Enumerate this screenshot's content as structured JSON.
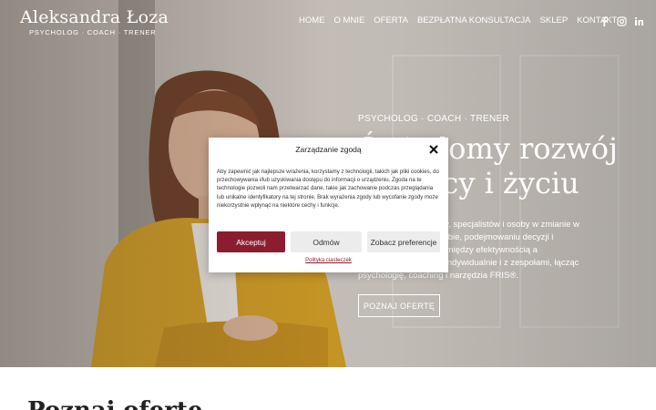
{
  "header": {
    "logo_name": "Aleksandra Łoza",
    "logo_tagline": "PSYCHOLOG · COACH · TRENER",
    "nav": [
      "HOME",
      "O MNIE",
      "OFERTA",
      "BEZPŁATNA KONSULTACJA",
      "SKLEP",
      "KONTAKT"
    ],
    "social_icons": [
      "facebook-icon",
      "instagram-icon",
      "linkedin-icon"
    ]
  },
  "hero": {
    "subtitle": "PSYCHOLOG · COACH · TRENER",
    "title_line1": "Świadomy rozwój",
    "title_line2": "w pracy i życiu",
    "body": "Wspieram menedżerów, specjalistów i osoby w zmianie w lepszym rozumieniu siebie, podejmowaniu decyzji i budowaniu równowagi między efektywnością a dobrostanem. Pracuję indywidualnie i z zespołami, łącząc psychologię, coaching i narzędzia FRIS®.",
    "button": "POZNAJ OFERTĘ"
  },
  "section": {
    "heading": "Poznaj ofertę"
  },
  "cookie_modal": {
    "title": "Zarządzanie zgodą",
    "text": "Aby zapewnić jak najlepsze wrażenia, korzystamy z technologii, takich jak pliki cookies, do przechowywania i/lub uzyskiwania dostępu do informacji o urządzeniu. Zgoda na te technologie pozwoli nam przetwarzać dane, takie jak zachowanie podczas przeglądania lub unikalne identyfikatory na tej stronie. Brak wyrażenia zgody lub wycofanie zgody może niekorzystnie wpłynąć na niektóre cechy i funkcje.",
    "accept": "Akceptuj",
    "deny": "Odmów",
    "preferences": "Zobacz preferencje",
    "policy_link": "Polityka ciasteczek"
  },
  "colors": {
    "accent": "#8c1d2e",
    "jacket": "#d9a21f"
  }
}
